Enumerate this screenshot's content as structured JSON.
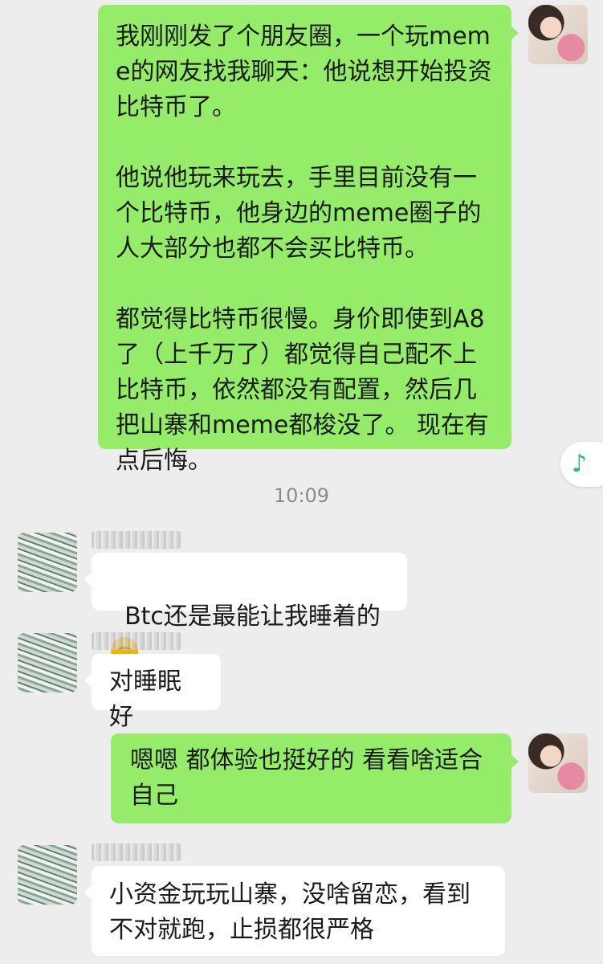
{
  "messages": [
    {
      "side": "right",
      "text": "我刚刚发了个朋友圈，一个玩meme的网友找我聊天：他说想开始投资比特币了。\n\n他说他玩来玩去，手里目前没有一个比特币，他身边的meme圈子的人大部分也都不会买比特币。\n\n都觉得比特币很慢。身价即使到A8了（上千万了）都觉得自己配不上比特币，依然都没有配置，然后几把山寨和meme都梭没了。 现在有点后悔。"
    },
    {
      "side": "left",
      "text": "Btc还是最能让我睡着的"
    },
    {
      "side": "left",
      "text": "对睡眠好"
    },
    {
      "side": "right",
      "text": "嗯嗯 都体验也挺好的 看看啥适合自己"
    },
    {
      "side": "left",
      "text": "小资金玩玩山寨，没啥留恋，看到不对就跑，止损都很严格"
    }
  ],
  "timestamp": "10:09",
  "floating_button": {
    "icon": "music-note-icon",
    "glyph": "♪"
  },
  "colors": {
    "sent_bubble": "#95ec69",
    "received_bubble": "#ffffff",
    "background": "#ededed",
    "timestamp": "#8a8a8a",
    "music_icon": "#2bb673"
  }
}
